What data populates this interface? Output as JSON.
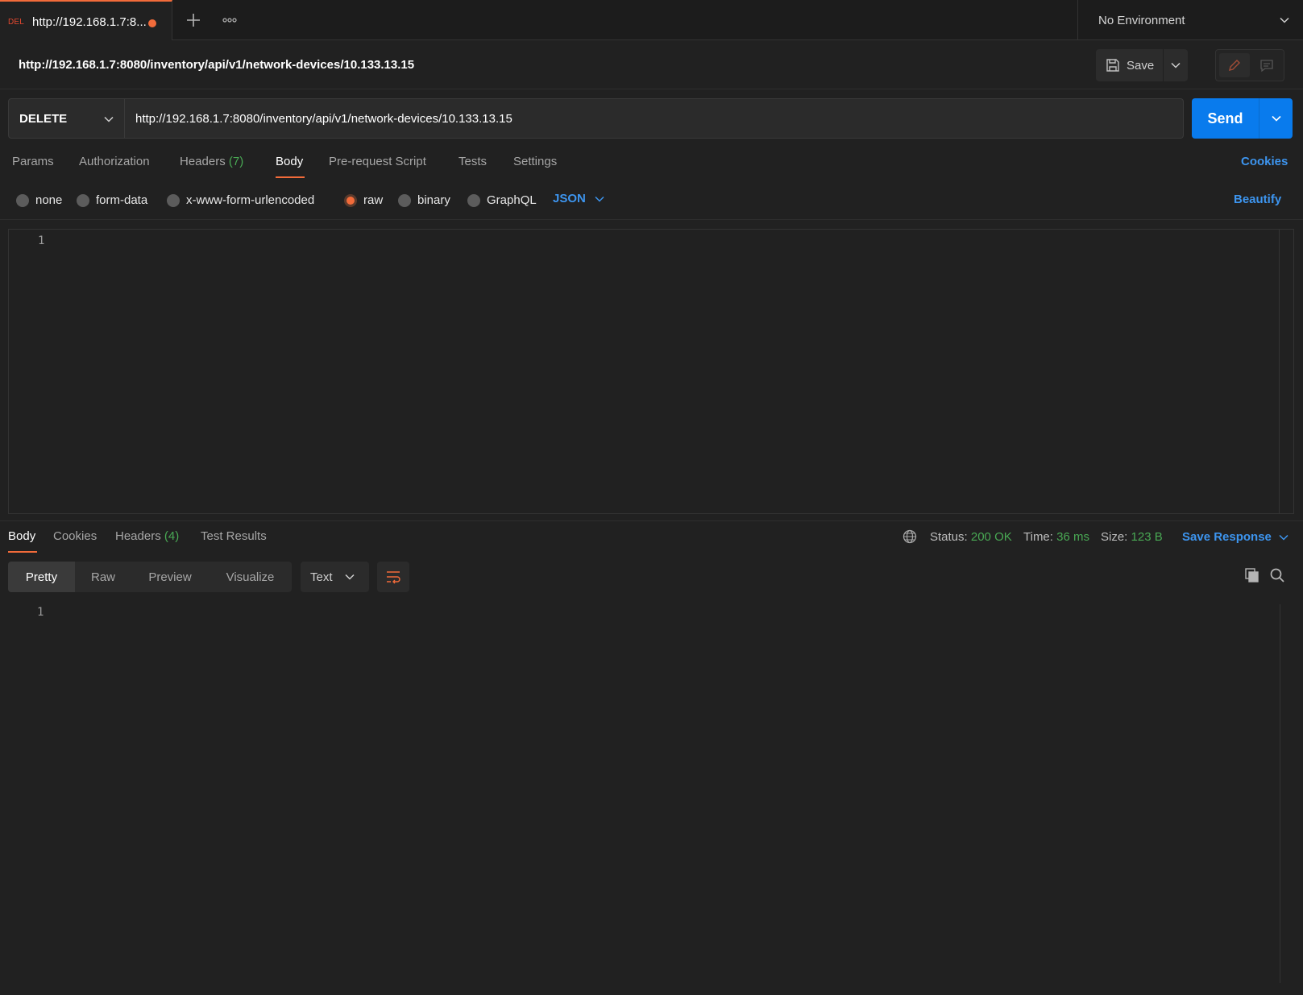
{
  "tab": {
    "method_badge": "DEL",
    "title": "http://192.168.1.7:8...",
    "unsaved_dot_color": "#f26b3a"
  },
  "environment": {
    "label": "No Environment"
  },
  "request": {
    "name": "http://192.168.1.7:8080/inventory/api/v1/network-devices/10.133.13.15",
    "method": "DELETE",
    "url": "http://192.168.1.7:8080/inventory/api/v1/network-devices/10.133.13.15",
    "save_label": "Save",
    "send_label": "Send"
  },
  "request_tabs": {
    "params": "Params",
    "authorization": "Authorization",
    "headers": "Headers",
    "headers_count": "(7)",
    "body": "Body",
    "pre_request": "Pre-request Script",
    "tests": "Tests",
    "settings": "Settings",
    "cookies": "Cookies",
    "active": "Body"
  },
  "body_types": {
    "options": [
      "none",
      "form-data",
      "x-www-form-urlencoded",
      "raw",
      "binary",
      "GraphQL"
    ],
    "selected": "raw",
    "format": "JSON",
    "beautify": "Beautify"
  },
  "request_editor": {
    "line_numbers": [
      "1"
    ]
  },
  "response_tabs": {
    "body": "Body",
    "cookies": "Cookies",
    "headers": "Headers",
    "headers_count": "(4)",
    "test_results": "Test Results",
    "active": "Body"
  },
  "response_meta": {
    "status_label": "Status:",
    "status_value": "200 OK",
    "time_label": "Time:",
    "time_value": "36 ms",
    "size_label": "Size:",
    "size_value": "123 B",
    "save_response": "Save Response"
  },
  "response_view": {
    "modes": [
      "Pretty",
      "Raw",
      "Preview",
      "Visualize"
    ],
    "active_mode": "Pretty",
    "format": "Text"
  },
  "response_editor": {
    "line_numbers": [
      "1"
    ]
  },
  "colors": {
    "accent": "#f26b3a",
    "link": "#3d95ef",
    "send": "#097bed",
    "success": "#49a954",
    "method_delete": "#e3482f"
  }
}
